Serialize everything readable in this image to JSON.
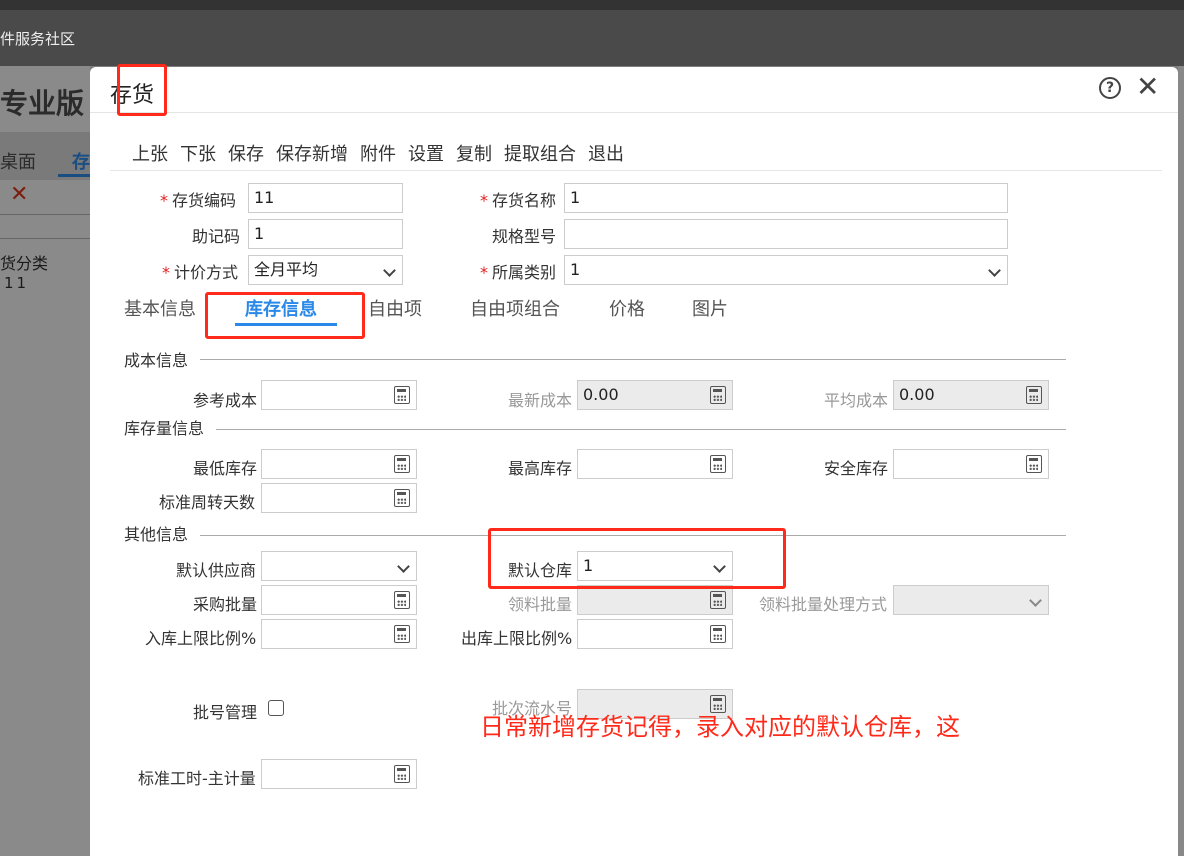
{
  "background_app": {
    "site_title": "件服务社区",
    "brand": "专业版",
    "tab_desktop": "桌面",
    "tab_current": "存",
    "category_label": "货分类",
    "category_item": "11"
  },
  "modal": {
    "title": "存货",
    "help_glyph": "?",
    "close_glyph": "✕"
  },
  "toolbar": [
    "上张",
    "下张",
    "保存",
    "保存新增",
    "附件",
    "设置",
    "复制",
    "提取组合",
    "退出"
  ],
  "header_fields": {
    "code": {
      "label": "存货编码",
      "value": "11",
      "required": "*"
    },
    "name": {
      "label": "存货名称",
      "value": "1",
      "required": "*"
    },
    "mnemonic": {
      "label": "助记码",
      "value": "1"
    },
    "spec": {
      "label": "规格型号",
      "value": ""
    },
    "pricing": {
      "label": "计价方式",
      "value": "全月平均",
      "required": "*"
    },
    "category": {
      "label": "所属类别",
      "value": "1",
      "required": "*"
    }
  },
  "tabs": [
    "基本信息",
    "库存信息",
    "自由项",
    "自由项组合",
    "价格",
    "图片"
  ],
  "active_tab": "库存信息",
  "sections": {
    "cost": "成本信息",
    "stock_qty": "库存量信息",
    "other": "其他信息"
  },
  "cost_fields": {
    "ref_cost": {
      "label": "参考成本",
      "value": ""
    },
    "latest_cost": {
      "label": "最新成本",
      "value": "0.00"
    },
    "avg_cost": {
      "label": "平均成本",
      "value": "0.00"
    }
  },
  "stock_fields": {
    "min": {
      "label": "最低库存",
      "value": ""
    },
    "max": {
      "label": "最高库存",
      "value": ""
    },
    "safety": {
      "label": "安全库存",
      "value": ""
    },
    "turnover": {
      "label": "标准周转天数",
      "value": ""
    }
  },
  "other_fields": {
    "supplier": {
      "label": "默认供应商",
      "value": ""
    },
    "warehouse": {
      "label": "默认仓库",
      "value": "1"
    },
    "purchase_batch": {
      "label": "采购批量",
      "value": ""
    },
    "pick_batch": {
      "label": "领料批量",
      "value": ""
    },
    "pick_batch_mode": {
      "label": "领料批量处理方式",
      "value": ""
    },
    "in_limit": {
      "label": "入库上限比例%",
      "value": ""
    },
    "out_limit": {
      "label": "出库上限比例%",
      "value": ""
    },
    "lot_mgmt": {
      "label": "批号管理",
      "checked": false
    },
    "lot_serial": {
      "label": "批次流水号",
      "value": ""
    },
    "std_hours": {
      "label": "标准工时-主计量",
      "value": ""
    }
  },
  "annotation_note": "日常新增存货记得，录入对应的默认仓库，这",
  "colors": {
    "accent": "#2a88e8",
    "required": "#e02020",
    "annotation": "#ff2a1a"
  }
}
